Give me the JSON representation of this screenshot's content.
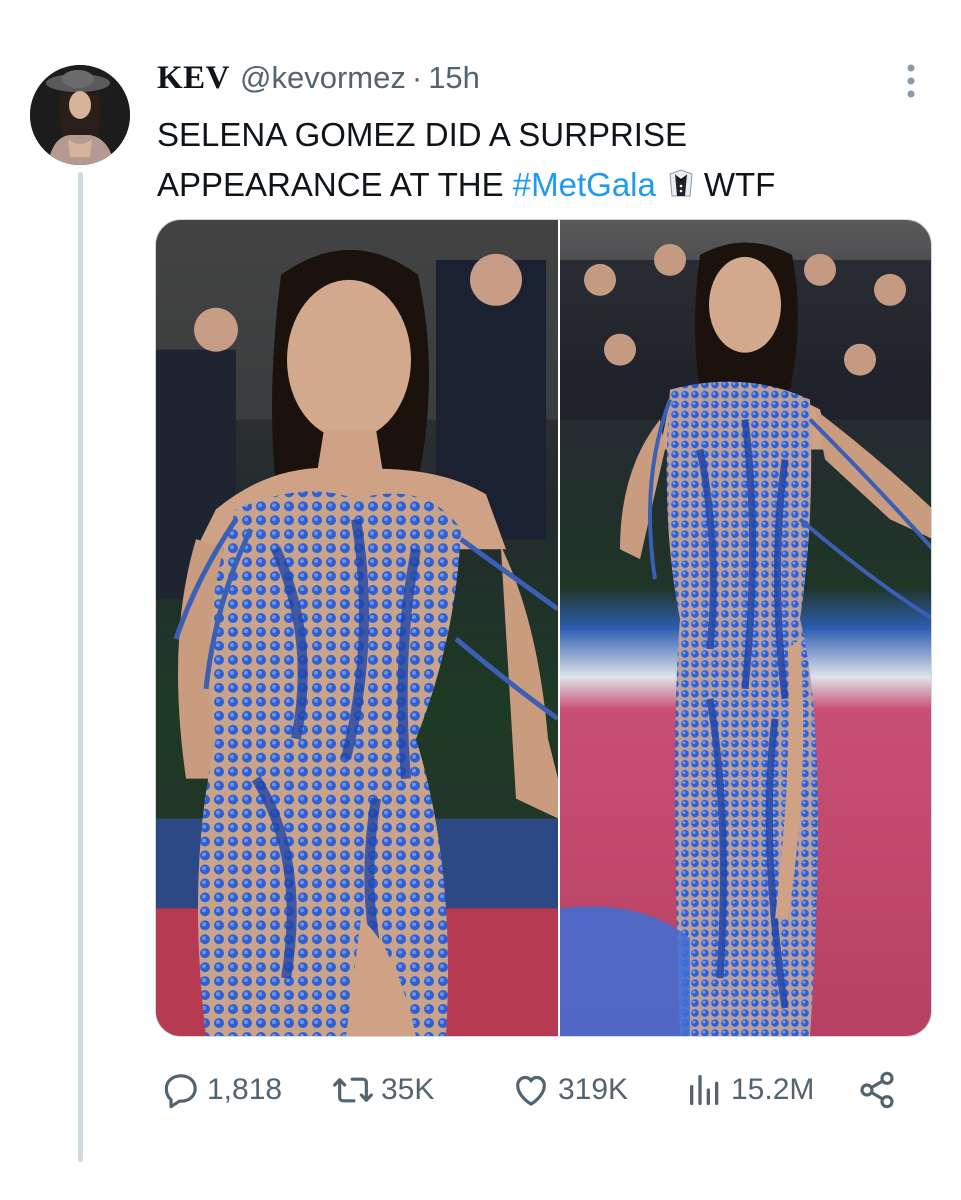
{
  "author": {
    "display_name": "KEV",
    "handle": "@kevormez",
    "separator": "·",
    "time_ago": "15h"
  },
  "tweet": {
    "line1": "SELENA GOMEZ DID A SURPRISE",
    "line2_prefix": "APPEARANCE AT THE ",
    "hashtag": "#MetGala",
    "line2_suffix": "WTF"
  },
  "media": {
    "photo_count": 2
  },
  "actions": {
    "replies": "1,818",
    "retweets": "35K",
    "likes": "319K",
    "views": "15.2M"
  },
  "icons": [
    "more-icon",
    "reply-icon",
    "retweet-icon",
    "like-icon",
    "views-icon",
    "share-icon",
    "tuxedo-emoji-icon"
  ],
  "colors": {
    "link": "#1d9bf0",
    "muted": "#536471",
    "text": "#0f1419",
    "thread_line": "#cfd9de",
    "dress_blue": "#2f5fd0"
  }
}
